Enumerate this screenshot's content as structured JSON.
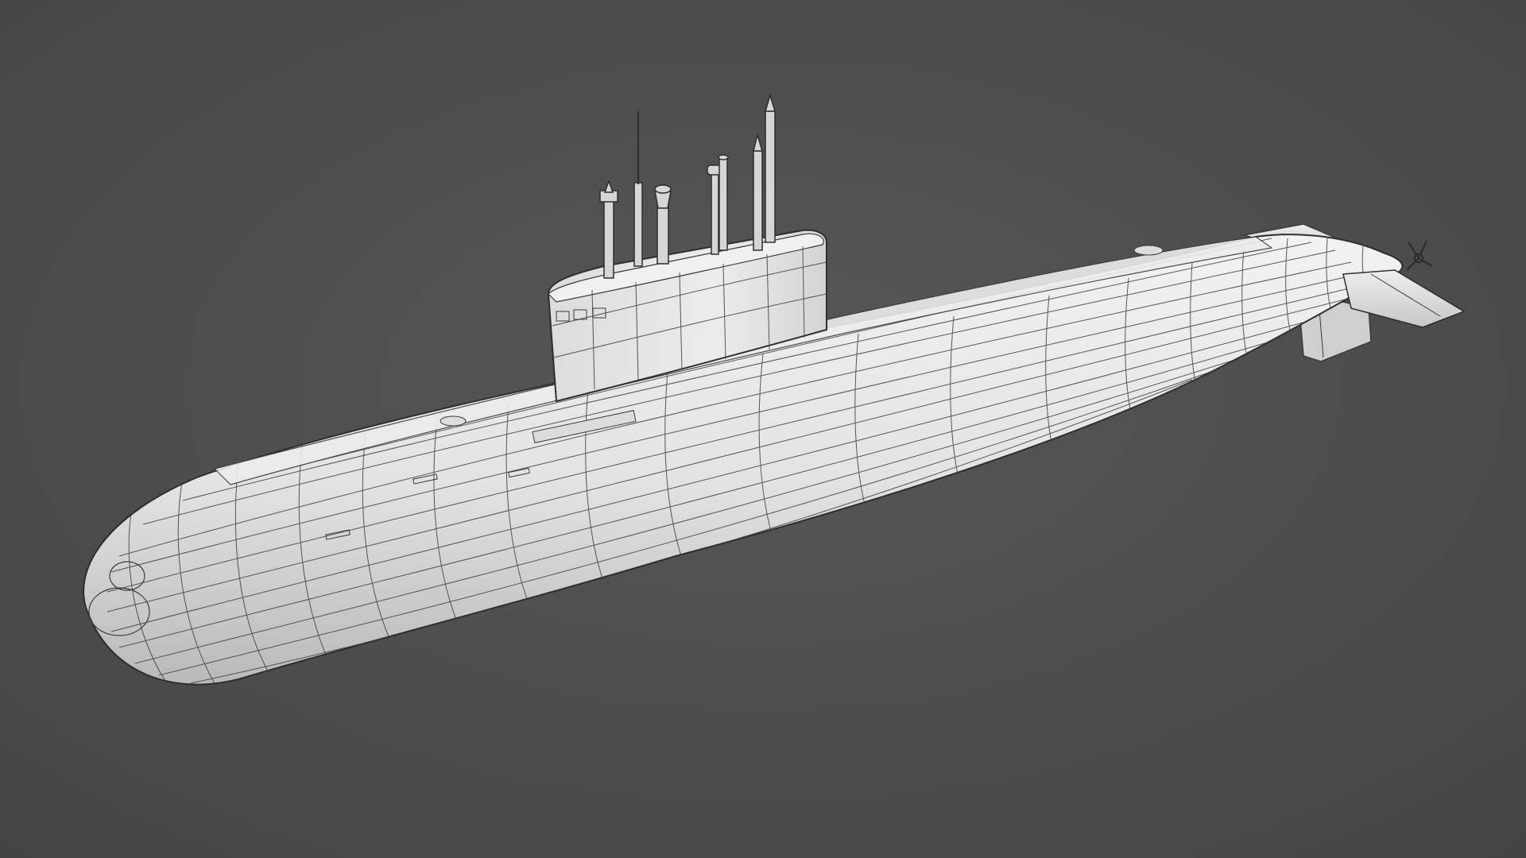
{
  "scene": {
    "subject": "submarine-wireframe-model",
    "background_color": "#4a4a4a",
    "background_center_color": "#575757",
    "model_color": "#e6e6e6",
    "wire_color": "#3a3a3a",
    "shadow_color": "#9a9a9a"
  }
}
